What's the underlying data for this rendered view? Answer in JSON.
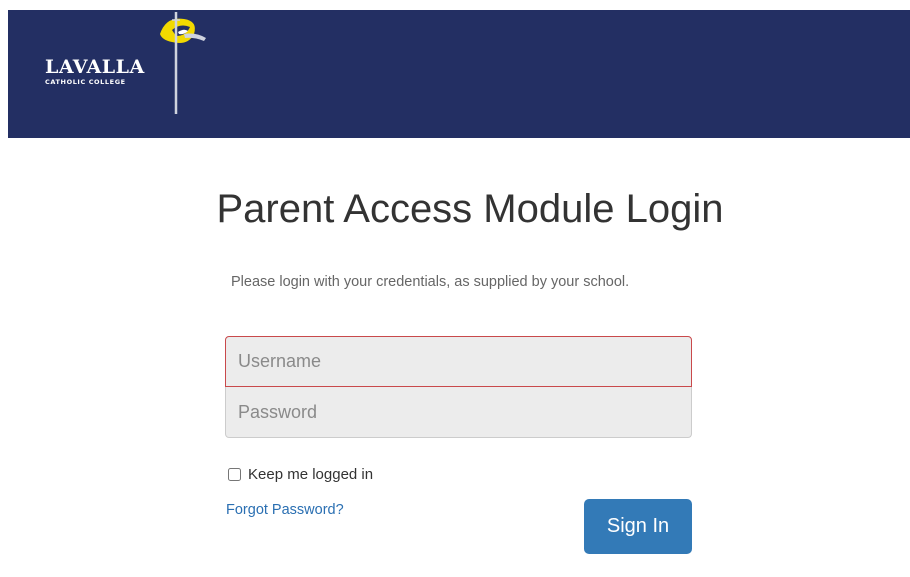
{
  "header": {
    "logo": {
      "name": "LAVALLA",
      "subtitle": "CATHOLIC COLLEGE",
      "icon": "lavalla-crest-icon",
      "colors": {
        "background": "#232f63",
        "accent": "#f2d900"
      }
    }
  },
  "main": {
    "title": "Parent Access Module Login",
    "intro": "Please login with your credentials, as supplied by your school.",
    "username": {
      "placeholder": "Username",
      "value": ""
    },
    "password": {
      "placeholder": "Password",
      "value": ""
    },
    "remember_label": "Keep me logged in",
    "forgot_label": "Forgot Password?",
    "signin_label": "Sign In"
  },
  "colors": {
    "header": "#232f63",
    "primary_button": "#337ab7",
    "link": "#2a6fb2",
    "error_border": "#c9494b"
  }
}
